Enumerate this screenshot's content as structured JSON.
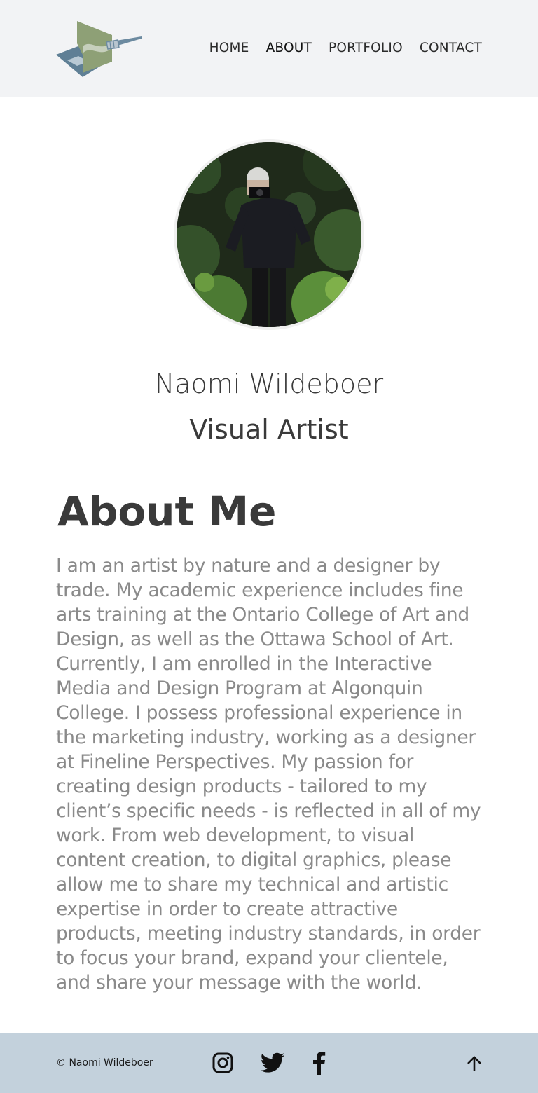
{
  "header": {
    "logo_icon": "brush-and-canvas-logo",
    "nav": [
      {
        "label": "HOME",
        "active": false
      },
      {
        "label": "ABOUT",
        "active": true
      },
      {
        "label": "PORTFOLIO",
        "active": false
      },
      {
        "label": "CONTACT",
        "active": false
      }
    ]
  },
  "profile": {
    "photo_icon": "profile-photo",
    "name": "Naomi Wildeboer",
    "role": "Visual Artist"
  },
  "about": {
    "title": "About Me",
    "body": "I am an artist by nature and a designer by trade. My academic experience includes fine arts training at the Ontario College of Art and Design, as well as the Ottawa School of Art. Currently, I am enrolled in the Interactive Media and Design Program at Algonquin College. I possess professional experience in the marketing industry, working as a designer at Fineline Perspectives. My passion for creating design products - tailored to my client’s specific needs - is reflected in all of my work. From web development, to visual content creation, to digital graphics, please allow me to share my technical and artistic expertise in order to create attractive products, meeting industry standards, in order to focus your brand, expand your clientele, and share your message with the world."
  },
  "footer": {
    "copyright": "© Naomi Wildeboer",
    "social": [
      "instagram-icon",
      "twitter-icon",
      "facebook-icon"
    ],
    "back_to_top_icon": "arrow-up-icon"
  },
  "colors": {
    "header_bg": "#f2f3f5",
    "footer_bg": "#c3d1dc",
    "logo_blue": "#5f7f95",
    "logo_green": "#8ea076"
  }
}
